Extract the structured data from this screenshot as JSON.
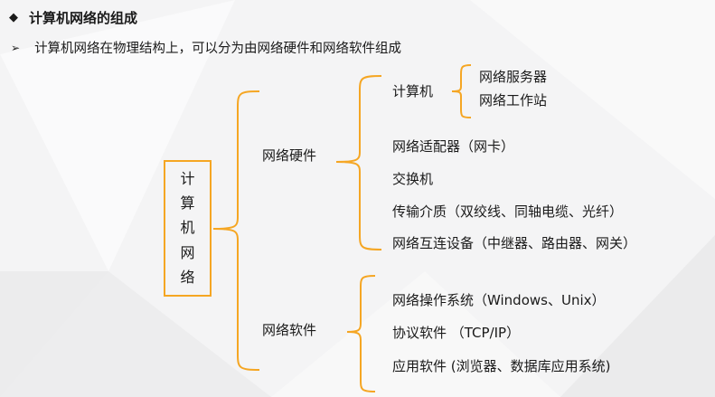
{
  "header": {
    "bullet": "◆",
    "title": "计算机网络的组成",
    "arrow": "➢",
    "subtitle": "计算机网络在物理结构上，可以分为由网络硬件和网络软件组成"
  },
  "tree": {
    "root": [
      "计",
      "算",
      "机",
      "网",
      "络"
    ],
    "hardware": {
      "label": "网络硬件",
      "computer": {
        "label": "计算机",
        "children": [
          "网络服务器",
          "网络工作站"
        ]
      },
      "items": [
        "网络适配器（网卡）",
        "交换机",
        "传输介质（双绞线、同轴电缆、光纤）",
        "网络互连设备（中继器、路由器、网关）"
      ]
    },
    "software": {
      "label": "网络软件",
      "items": [
        "网络操作系统（Windows、Unix）",
        "协议软件 （TCP/IP）",
        "应用软件 (浏览器、数据库应用系统)"
      ]
    }
  },
  "colors": {
    "bracket": "#f5a623",
    "background": "#f4f4f5"
  }
}
